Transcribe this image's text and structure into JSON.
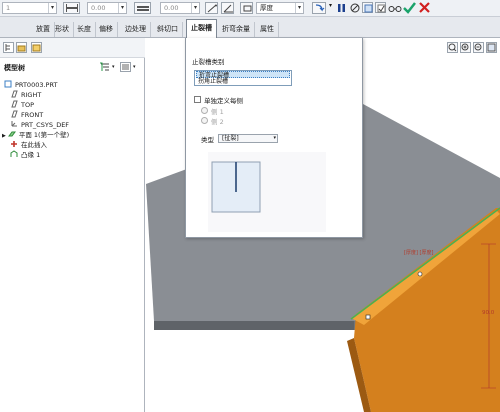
{
  "toolbar": {
    "field1_value": "1",
    "field2_value": "0.00",
    "field3_value": "0.00",
    "thickness_label": "厚度",
    "icons": [
      "dimension-icon",
      "flip-icon",
      "pause-icon",
      "stop-icon",
      "preview-icon",
      "verify-icon",
      "glasses-icon",
      "ok-icon",
      "cancel-icon"
    ],
    "accent_ok": "#1aa36b",
    "accent_cancel": "#d11f1f"
  },
  "tabs": [
    {
      "label": "放置"
    },
    {
      "label": "形状"
    },
    {
      "label": "长度"
    },
    {
      "label": "偏移"
    },
    {
      "label": "边处理"
    },
    {
      "label": "斜切口"
    },
    {
      "label": "止裂槽",
      "active": true
    },
    {
      "label": "折弯余量"
    },
    {
      "label": "属性"
    }
  ],
  "model_tree": {
    "title": "模型树",
    "items": [
      {
        "label": "PRT0003.PRT"
      },
      {
        "label": "RIGHT"
      },
      {
        "label": "TOP"
      },
      {
        "label": "FRONT"
      },
      {
        "label": "PRT_CSYS_DEF"
      },
      {
        "label": "平面 1(第一个壁)"
      },
      {
        "label": "在此插入"
      },
      {
        "label": "凸缘 1"
      }
    ]
  },
  "relief_panel": {
    "category_label": "止裂槽类别",
    "category_options": [
      "折弯止裂槽",
      "拐角止裂槽"
    ],
    "separate_label": "单独定义每侧",
    "side1_label": "侧 1",
    "side2_label": "侧 2",
    "type_label": "类型",
    "type_value": "[扯裂]"
  },
  "model_annotations": {
    "thickness_tag": "[厚度] [厚度]",
    "dim_value": "90.0"
  }
}
